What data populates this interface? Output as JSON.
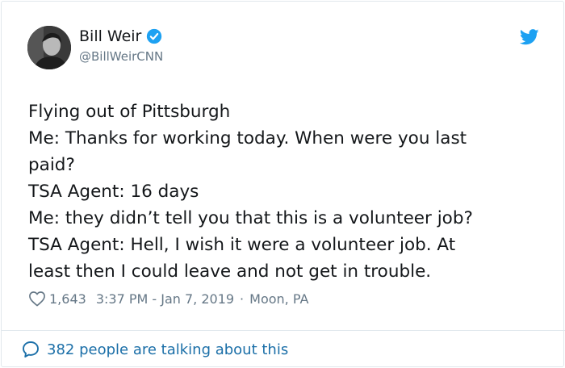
{
  "author": {
    "name": "Bill Weir",
    "handle": "@BillWeirCNN",
    "verified": true,
    "avatar_icon": "avatar-photo"
  },
  "tweet": {
    "lines": [
      "Flying out of Pittsburgh",
      "Me: Thanks for working today. When were you last",
      "paid?",
      "TSA Agent: 16 days",
      "Me: they didn’t tell you that this is a volunteer job?",
      "TSA Agent: Hell, I wish it were a volunteer job. At",
      "least then I could leave and not get in trouble."
    ]
  },
  "meta": {
    "likes": "1,643",
    "timestamp": "3:37 PM - Jan 7, 2019",
    "separator": "·",
    "location": "Moon, PA"
  },
  "footer": {
    "talking_label": "382 people are talking about this"
  },
  "colors": {
    "brand_blue": "#1da1f2",
    "link_blue": "#1b6fa8",
    "muted": "#657786",
    "text": "#14171a",
    "border": "#e1e8ed"
  }
}
